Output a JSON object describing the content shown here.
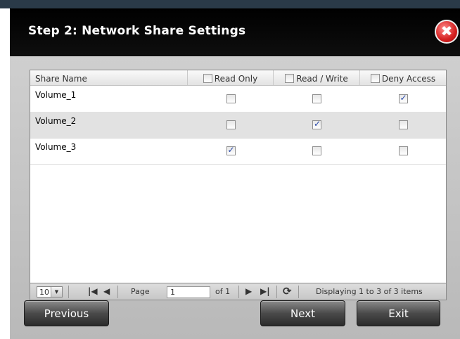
{
  "dialog": {
    "title": "Step 2: Network Share Settings",
    "close_glyph": "✖"
  },
  "table": {
    "columns": [
      "Share Name",
      "Read Only",
      "Read / Write",
      "Deny Access"
    ],
    "rows": [
      {
        "name": "Volume_1",
        "read_only": false,
        "read_write": false,
        "deny_access": true
      },
      {
        "name": "Volume_2",
        "read_only": false,
        "read_write": true,
        "deny_access": false
      },
      {
        "name": "Volume_3",
        "read_only": true,
        "read_write": false,
        "deny_access": false
      }
    ]
  },
  "pager": {
    "page_size": "10",
    "page_label": "Page",
    "page_value": "1",
    "of_label": "of 1",
    "status": "Displaying 1 to 3 of 3 items"
  },
  "buttons": {
    "previous": "Previous",
    "next": "Next",
    "exit": "Exit"
  },
  "colors": {
    "title_bar": "#000000",
    "close_button": "#d42020",
    "panel": "#c4c4c4",
    "alt_row": "#e2e2e2",
    "check_mark": "#2545a8"
  }
}
